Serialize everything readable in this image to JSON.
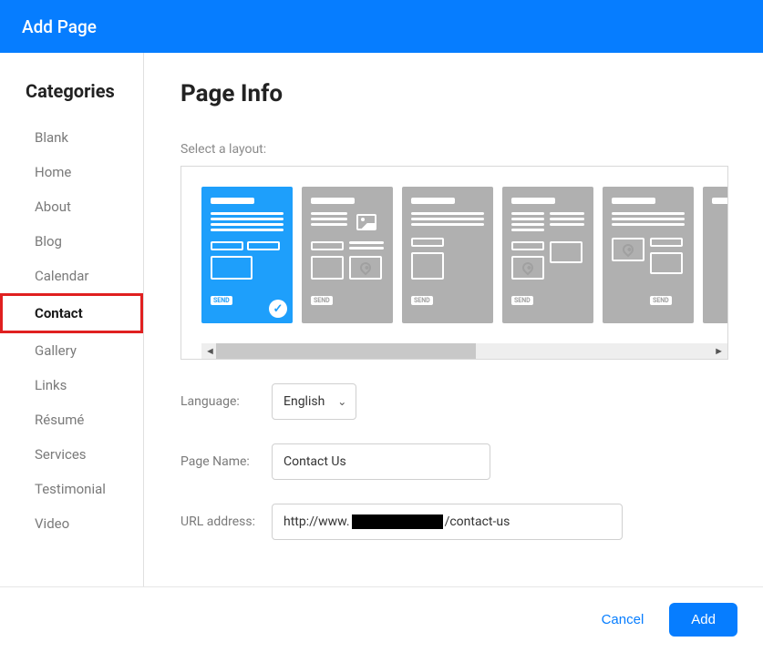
{
  "header": {
    "title": "Add Page"
  },
  "sidebar": {
    "heading": "Categories",
    "items": [
      {
        "label": "Blank"
      },
      {
        "label": "Home"
      },
      {
        "label": "About"
      },
      {
        "label": "Blog"
      },
      {
        "label": "Calendar"
      },
      {
        "label": "Contact",
        "selected": true
      },
      {
        "label": "Gallery"
      },
      {
        "label": "Links"
      },
      {
        "label": "Résumé"
      },
      {
        "label": "Services"
      },
      {
        "label": "Testimonial"
      },
      {
        "label": "Video"
      }
    ]
  },
  "main": {
    "title": "Page Info",
    "layout_label": "Select a layout:",
    "send_badge": "SEND",
    "selected_layout_index": 0,
    "language_label": "Language:",
    "language_value": "English",
    "pagename_label": "Page Name:",
    "pagename_value": "Contact Us",
    "url_label": "URL address:",
    "url_prefix": "http://www.",
    "url_suffix": "/contact-us"
  },
  "footer": {
    "cancel": "Cancel",
    "add": "Add"
  }
}
